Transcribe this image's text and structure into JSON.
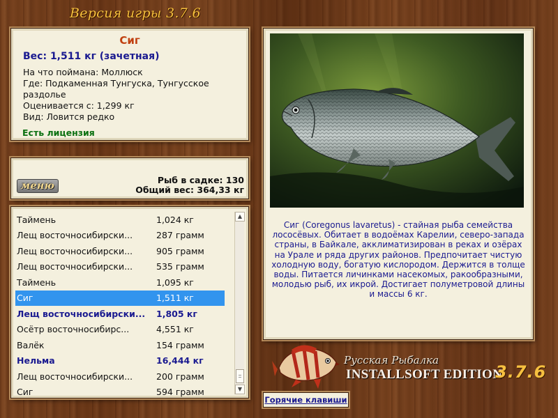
{
  "header": {
    "title": "Версия игры 3.7.6"
  },
  "fish_info": {
    "name": "Сиг",
    "weight_line": "Вес: 1,511 кг (зачетная)",
    "caught_on": "На что поймана: Моллюск",
    "where": "Где: Подкаменная Тунгуска, Тунгусское раздолье",
    "valued_from": "Оценивается с: 1,299 кг",
    "kind": "Вид: Ловится редко",
    "license": "Есть лицензия"
  },
  "keepnet": {
    "menu_label": "меню",
    "fish_count": "Рыб в садке: 130",
    "total_weight": "Общий вес: 364,33 кг"
  },
  "catch_list": {
    "rows": [
      {
        "name": "Таймень",
        "weight": "1,024 кг",
        "style": "normal"
      },
      {
        "name": "Лещ восточносибирски...",
        "weight": "287 грамм",
        "style": "normal"
      },
      {
        "name": "Лещ восточносибирски...",
        "weight": "905 грамм",
        "style": "normal"
      },
      {
        "name": "Лещ восточносибирски...",
        "weight": "535 грамм",
        "style": "normal"
      },
      {
        "name": "Таймень",
        "weight": "1,095 кг",
        "style": "normal"
      },
      {
        "name": "Сиг",
        "weight": "1,511 кг",
        "style": "selected"
      },
      {
        "name": "Лещ восточносибирски...",
        "weight": "1,805 кг",
        "style": "bold"
      },
      {
        "name": "Осётр восточносибирс...",
        "weight": "4,551 кг",
        "style": "normal"
      },
      {
        "name": "Валёк",
        "weight": "154 грамм",
        "style": "normal"
      },
      {
        "name": "Нельма",
        "weight": "16,444 кг",
        "style": "bold"
      },
      {
        "name": "Лещ восточносибирски...",
        "weight": "200 грамм",
        "style": "normal"
      },
      {
        "name": "Сиг",
        "weight": "594 грамм",
        "style": "normal"
      }
    ],
    "scroll_up_icon": "triangle-up",
    "scroll_down_icon": "triangle-down"
  },
  "description": "Сиг (Coregonus lavaretus) - стайная рыба семейства лососёвых. Обитает в водоёмах Карелии, северо-запада страны, в Байкале, акклиматизирован в реках и озёрах на Урале и ряда других районов. Предпочитает чистую холодную воду, богатую кислородом. Держится в толще воды. Питается личинками насекомых, ракообразными, молодью рыб, их икрой. Достигает полуметровой длины и массы 6 кг.",
  "logo": {
    "line1": "Русская Рыбалка",
    "line2": "INSTALLSOFT EDITION",
    "version": "3.7.6"
  },
  "hotkeys_label": "Горячие клавиши",
  "colors": {
    "name_accent": "#c04010",
    "link_blue": "#1a1a90",
    "license_green": "#0a7010",
    "selection": "#3294ee",
    "gold": "#f6c040"
  }
}
